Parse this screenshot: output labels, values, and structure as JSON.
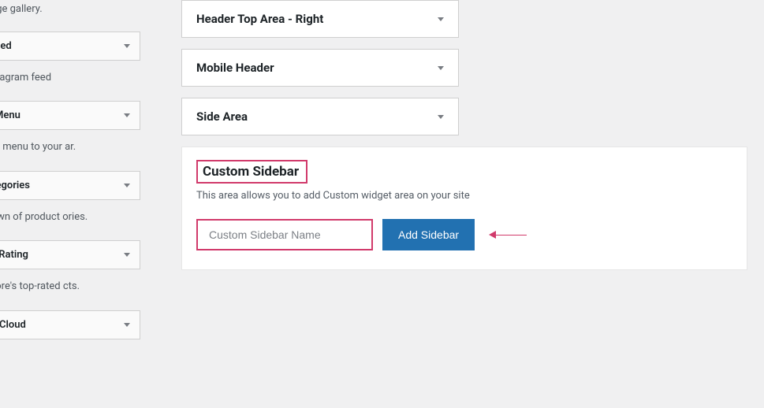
{
  "left": {
    "desc0": "ys an image gallery.",
    "w1": {
      "title": "gram Feed",
      "desc": "y your Instagram feed"
    },
    "w2": {
      "title": "gation Menu",
      "desc": "navigation menu to your ar."
    },
    "w3": {
      "title": "uct Categories",
      "desc": "or dropdown of product ories."
    },
    "w4": {
      "title": "ucts by Rating",
      "desc": "of your store's top-rated cts."
    },
    "w5": {
      "title": "uct Tag Cloud"
    }
  },
  "areas": {
    "a1": "Header Top Area - Right",
    "a2": "Mobile Header",
    "a3": "Side Area"
  },
  "custom": {
    "title": "Custom Sidebar",
    "desc": "This area allows you to add Custom widget area on your site",
    "placeholder": "Custom Sidebar Name",
    "button": "Add Sidebar"
  }
}
